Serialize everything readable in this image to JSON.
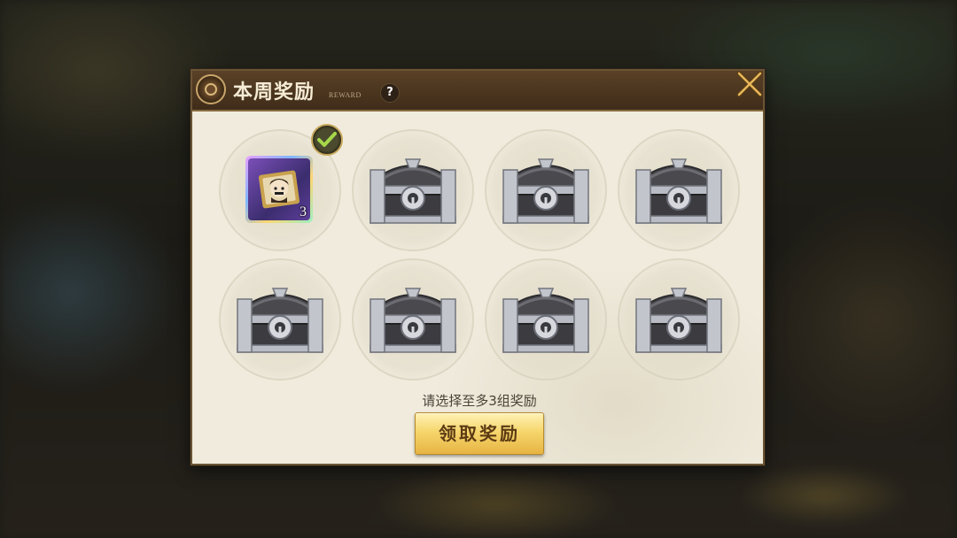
{
  "dialog": {
    "title": "本周奖励",
    "subtitle": "REWARD",
    "help_label": "?"
  },
  "rewards": {
    "selected_item": {
      "count": "3",
      "selected": true
    },
    "chest_count_unselected": 7
  },
  "footer": {
    "hint": "请选择至多3组奖励",
    "claim_label": "领取奖励"
  },
  "colors": {
    "panel": "#f0ebdd",
    "titlebar": "#4a341f",
    "button_gold": "#f6d66c",
    "check_green": "#a6d84a"
  }
}
